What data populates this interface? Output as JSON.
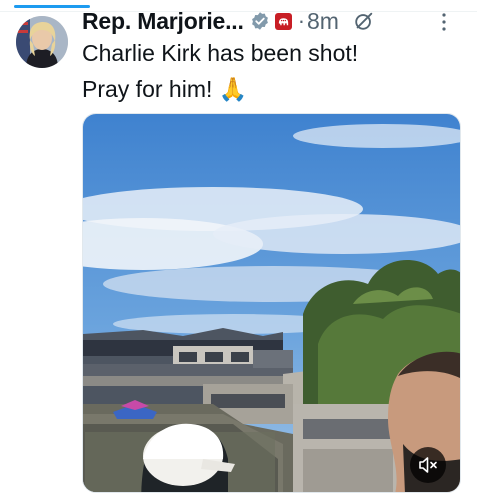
{
  "tweet": {
    "author_name": "Rep. Marjorie...",
    "separator": "·",
    "time": "8m",
    "text_line1": "Charlie Kirk has been shot!",
    "text_line2": "Pray for him! 🙏"
  },
  "icons": {
    "verified": "verified-badge-icon",
    "party": "gop-elephant-icon",
    "grok": "grok-icon",
    "more": "more-options-icon",
    "mute": "muted-speaker-icon"
  },
  "colors": {
    "accent": "#1d9bf0",
    "party_badge": "#c81e25",
    "muted_text": "#536471"
  }
}
